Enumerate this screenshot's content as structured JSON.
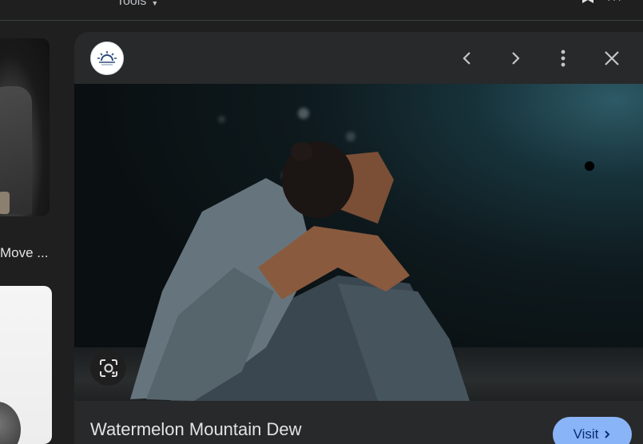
{
  "header": {
    "tools_label": "Tools"
  },
  "results": {
    "thumb_caption": "Move ..."
  },
  "viewer": {
    "source_logo": "sun-logo",
    "title": "Watermelon Mountain Dew",
    "visit_label": "Visit",
    "icons": [
      "chevron-left-icon",
      "chevron-right-icon",
      "more-vert-icon",
      "close-icon",
      "lens-icon"
    ]
  },
  "colors": {
    "background": "#1f1f1f",
    "panel": "#28292a",
    "accent": "#8ab4f8"
  }
}
